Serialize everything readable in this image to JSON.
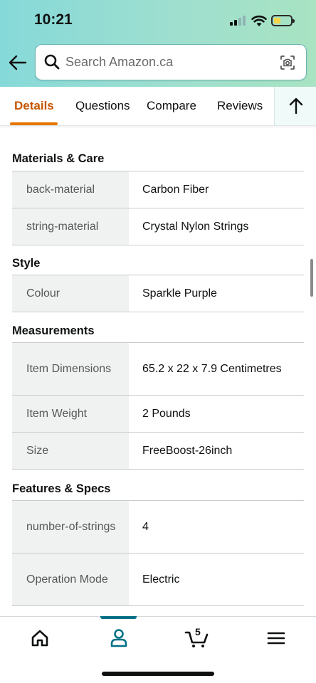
{
  "status_bar": {
    "time": "10:21"
  },
  "search": {
    "placeholder": "Search Amazon.ca"
  },
  "tabs": [
    {
      "label": "Details",
      "active": true
    },
    {
      "label": "Questions",
      "active": false
    },
    {
      "label": "Compare",
      "active": false
    },
    {
      "label": "Reviews",
      "active": false
    }
  ],
  "sections": [
    {
      "title": "Materials & Care",
      "rows": [
        {
          "key": "back-material",
          "value": "Carbon Fiber"
        },
        {
          "key": "string-material",
          "value": "Crystal Nylon Strings"
        }
      ]
    },
    {
      "title": "Style",
      "rows": [
        {
          "key": "Colour",
          "value": "Sparkle Purple"
        }
      ]
    },
    {
      "title": "Measurements",
      "rows": [
        {
          "key": "Item Dimensions",
          "value": "65.2 x 22 x 7.9 Centimetres"
        },
        {
          "key": "Item Weight",
          "value": "2 Pounds"
        },
        {
          "key": "Size",
          "value": "FreeBoost-26inch"
        }
      ]
    },
    {
      "title": "Features & Specs",
      "rows": [
        {
          "key": "number-of-strings",
          "value": "4"
        },
        {
          "key": "Operation Mode",
          "value": "Electric"
        }
      ]
    }
  ],
  "bottom_nav": {
    "items": [
      {
        "icon": "home-icon",
        "active": false
      },
      {
        "icon": "account-icon",
        "active": true
      },
      {
        "icon": "cart-icon",
        "active": false
      },
      {
        "icon": "menu-icon",
        "active": false
      }
    ],
    "cart_count": "5"
  },
  "colors": {
    "header_gradient_start": "#86d9d9",
    "header_gradient_end": "#a8e3c2",
    "active_tab": "#c45500",
    "active_tab_underline": "#e77600",
    "active_nav": "#007185"
  }
}
